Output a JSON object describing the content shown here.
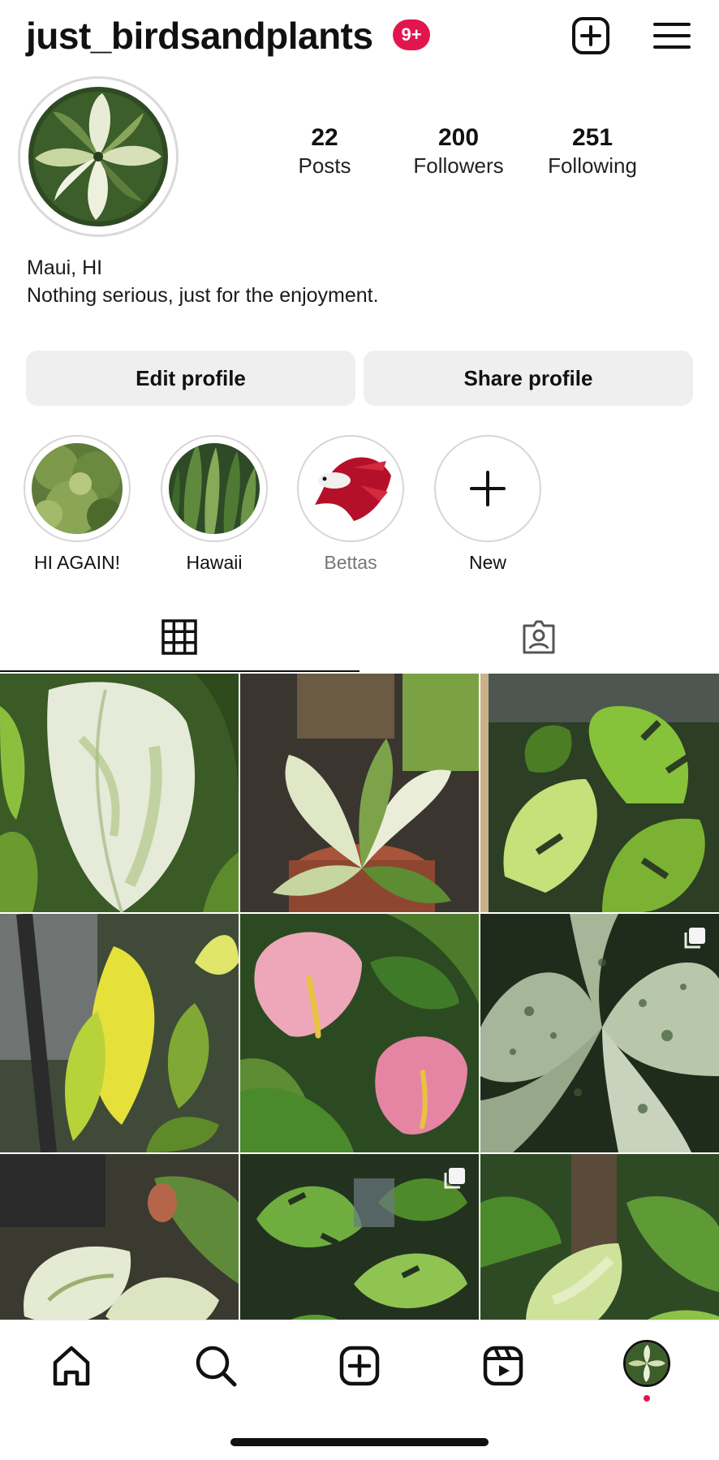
{
  "header": {
    "username": "just_birdsandplants",
    "notification_badge": "9+",
    "badge_color": "#e2164e"
  },
  "stats": {
    "posts": {
      "value": "22",
      "label": "Posts"
    },
    "followers": {
      "value": "200",
      "label": "Followers"
    },
    "following": {
      "value": "251",
      "label": "Following"
    }
  },
  "bio": {
    "location": "Maui, HI",
    "text": "Nothing serious, just for the enjoyment."
  },
  "buttons": {
    "edit_profile": "Edit profile",
    "share_profile": "Share profile"
  },
  "highlights": [
    {
      "label": "HI AGAIN!",
      "icon": "highlight-cover-greenery"
    },
    {
      "label": "Hawaii",
      "icon": "highlight-cover-leaves"
    },
    {
      "label": "Bettas",
      "icon": "highlight-cover-betta-fish"
    },
    {
      "label": "New",
      "icon": "plus-icon"
    }
  ],
  "tabs": [
    {
      "name": "posts-grid",
      "icon": "grid-icon",
      "active": true
    },
    {
      "name": "tagged",
      "icon": "tagged-person-icon",
      "active": false
    }
  ],
  "posts": [
    {
      "subject": "variegated philodendron leaf",
      "multi": false
    },
    {
      "subject": "variegated monstera in clay pot",
      "multi": false
    },
    {
      "subject": "variegated monstera",
      "multi": false
    },
    {
      "subject": "yellow philodendron leaf",
      "multi": false
    },
    {
      "subject": "pink anthurium flowers",
      "multi": false
    },
    {
      "subject": "marbled variegated leaves",
      "multi": true
    },
    {
      "subject": "variegated pothos",
      "multi": false
    },
    {
      "subject": "rhaphidophora leaves",
      "multi": true
    },
    {
      "subject": "variegated plant on moss pole",
      "multi": false
    }
  ],
  "bottom_nav": [
    {
      "name": "home",
      "icon": "home-icon"
    },
    {
      "name": "search",
      "icon": "search-icon"
    },
    {
      "name": "create",
      "icon": "create-icon"
    },
    {
      "name": "reels",
      "icon": "reels-icon"
    },
    {
      "name": "profile",
      "icon": "profile-avatar-icon"
    }
  ]
}
